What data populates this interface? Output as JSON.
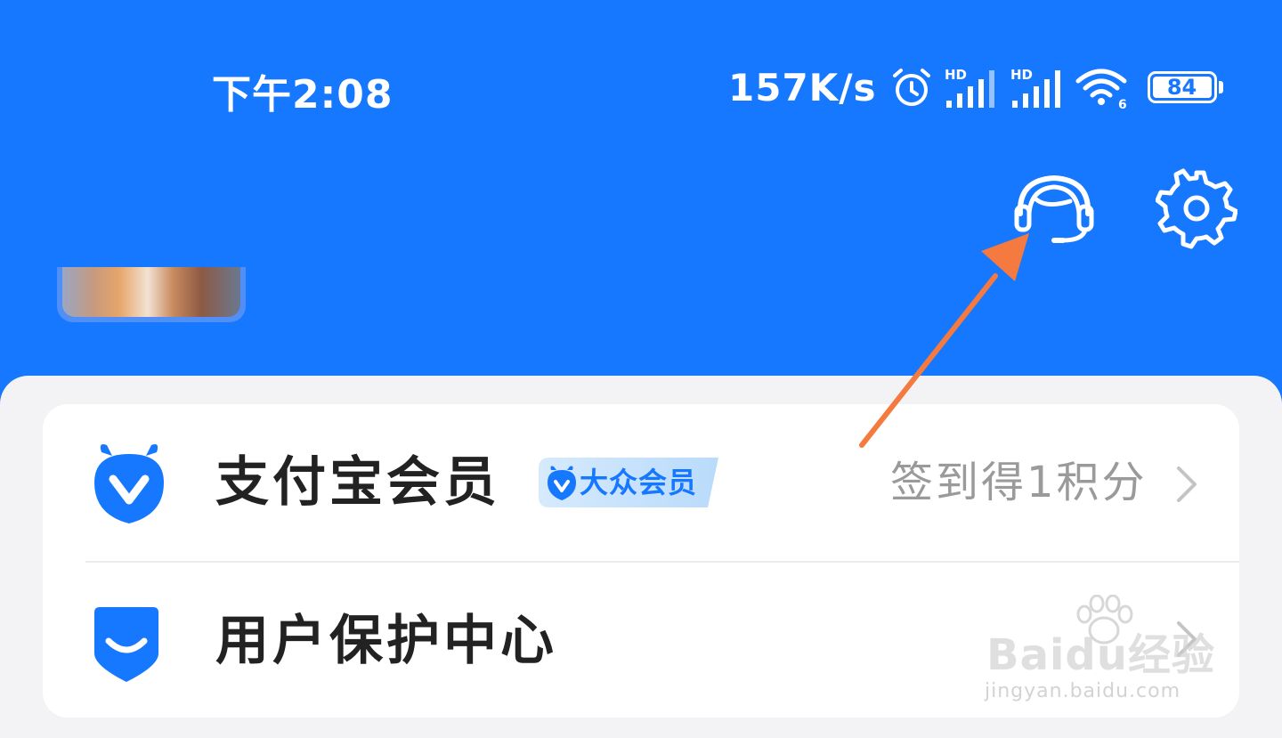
{
  "status_bar": {
    "time": "下午2:08",
    "net_speed": "157K/s",
    "signal_1_label": "HD",
    "signal_2_label": "HD",
    "wifi_label": "6",
    "battery": "84",
    "icons": [
      "alarm-icon",
      "signal-icon",
      "signal-icon",
      "wifi-icon",
      "battery-icon"
    ]
  },
  "header": {
    "background_color": "#1677ff",
    "icons": [
      "customer-service-icon",
      "gear-icon"
    ]
  },
  "menu": {
    "member": {
      "label": "支付宝会员",
      "badge": "大众会员",
      "right_text": "签到得1积分",
      "icon": "member-icon"
    },
    "protect": {
      "label": "用户保护中心",
      "icon": "shield-smile-icon"
    }
  },
  "watermark": {
    "text": "Baidu经验",
    "url": "jingyan.baidu.com"
  },
  "colors": {
    "accent": "#1677ff",
    "annotation_arrow": "#f47a3f",
    "secondary_text": "#9a9a9a"
  }
}
